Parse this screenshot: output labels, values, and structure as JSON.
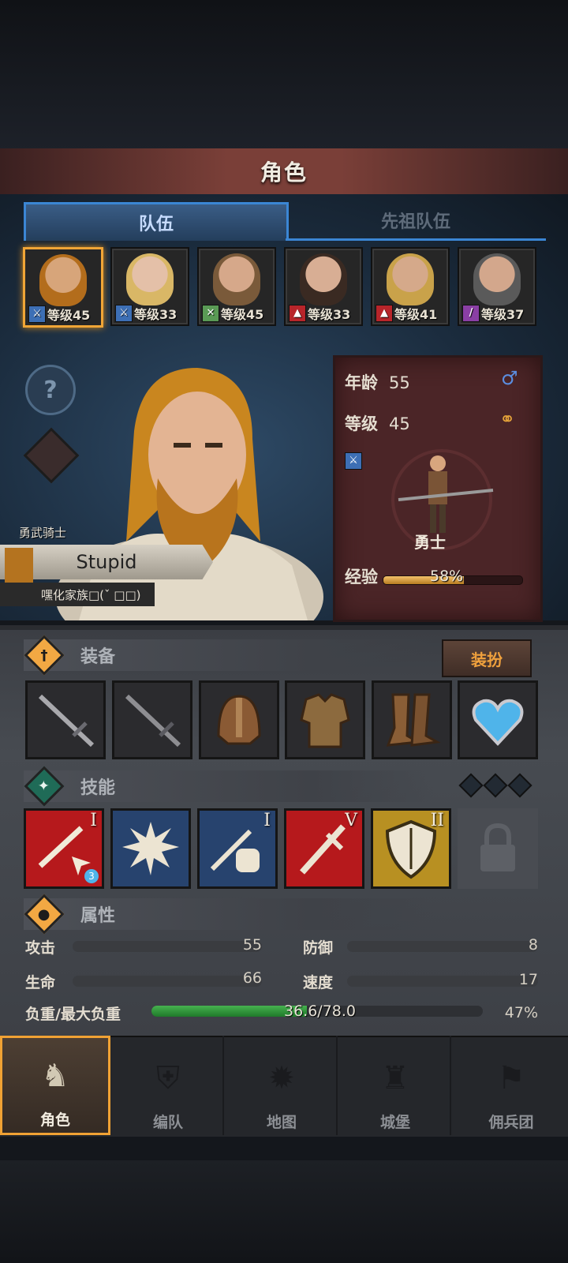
{
  "header": {
    "title": "角色"
  },
  "tabs": [
    {
      "label": "队伍",
      "active": true
    },
    {
      "label": "先祖队伍",
      "active": false
    }
  ],
  "party": [
    {
      "class_icon": "sword-icon",
      "class_color": "#3d6fb5",
      "level": "等级45",
      "selected": true
    },
    {
      "class_icon": "sword-icon",
      "class_color": "#3d6fb5",
      "level": "等级33",
      "selected": false
    },
    {
      "class_icon": "crossed-arrows-icon",
      "class_color": "#5a9a55",
      "level": "等级45",
      "selected": false
    },
    {
      "class_icon": "wolf-icon",
      "class_color": "#b8252a",
      "level": "等级33",
      "selected": false
    },
    {
      "class_icon": "wolf-icon",
      "class_color": "#b8252a",
      "level": "等级41",
      "selected": false
    },
    {
      "class_icon": "staff-icon",
      "class_color": "#8a3fa4",
      "level": "等级37",
      "selected": false
    }
  ],
  "hero": {
    "class_title": "勇武骑士",
    "name": "Stupid",
    "family": "嘿化家族□(ˇ □□)"
  },
  "stat_card": {
    "age_label": "年龄",
    "age_value": "55",
    "level_label": "等级",
    "level_value": "45",
    "class_name": "勇士",
    "exp_label": "经验",
    "exp_percent": "58%",
    "exp_fraction": 0.58
  },
  "equipment": {
    "title": "装备",
    "dress_button": "装扮",
    "items": [
      "sword-icon",
      "sword-icon",
      "helmet-icon",
      "armor-icon",
      "boots-icon",
      "heart-amulet-icon"
    ]
  },
  "skills": {
    "title": "技能",
    "items": [
      {
        "icon": "sword-cursor-icon",
        "tier": "I",
        "color": "#b6191c",
        "badge": "3"
      },
      {
        "icon": "fist-burst-icon",
        "tier": "",
        "color": "#27436e",
        "badge": ""
      },
      {
        "icon": "fist-sword-icon",
        "tier": "I",
        "color": "#27436e",
        "badge": ""
      },
      {
        "icon": "sword-icon",
        "tier": "V",
        "color": "#b6191c",
        "badge": ""
      },
      {
        "icon": "shield-icon",
        "tier": "II",
        "color": "#b89022",
        "badge": ""
      }
    ]
  },
  "attributes": {
    "title": "属性",
    "attack_label": "攻击",
    "attack_value": "55",
    "defense_label": "防御",
    "defense_value": "8",
    "life_label": "生命",
    "life_value": "66",
    "speed_label": "速度",
    "speed_value": "17",
    "load_label": "负重/最大负重",
    "load_value": "36.6/78.0",
    "load_percent": "47%",
    "load_fraction": 0.47
  },
  "nav": [
    {
      "label": "角色",
      "icon": "knight-icon",
      "active": true
    },
    {
      "label": "编队",
      "icon": "helmet-group-icon",
      "active": false
    },
    {
      "label": "地图",
      "icon": "compass-icon",
      "active": false
    },
    {
      "label": "城堡",
      "icon": "castle-icon",
      "active": false
    },
    {
      "label": "佣兵团",
      "icon": "mercenary-icon",
      "active": false
    }
  ]
}
